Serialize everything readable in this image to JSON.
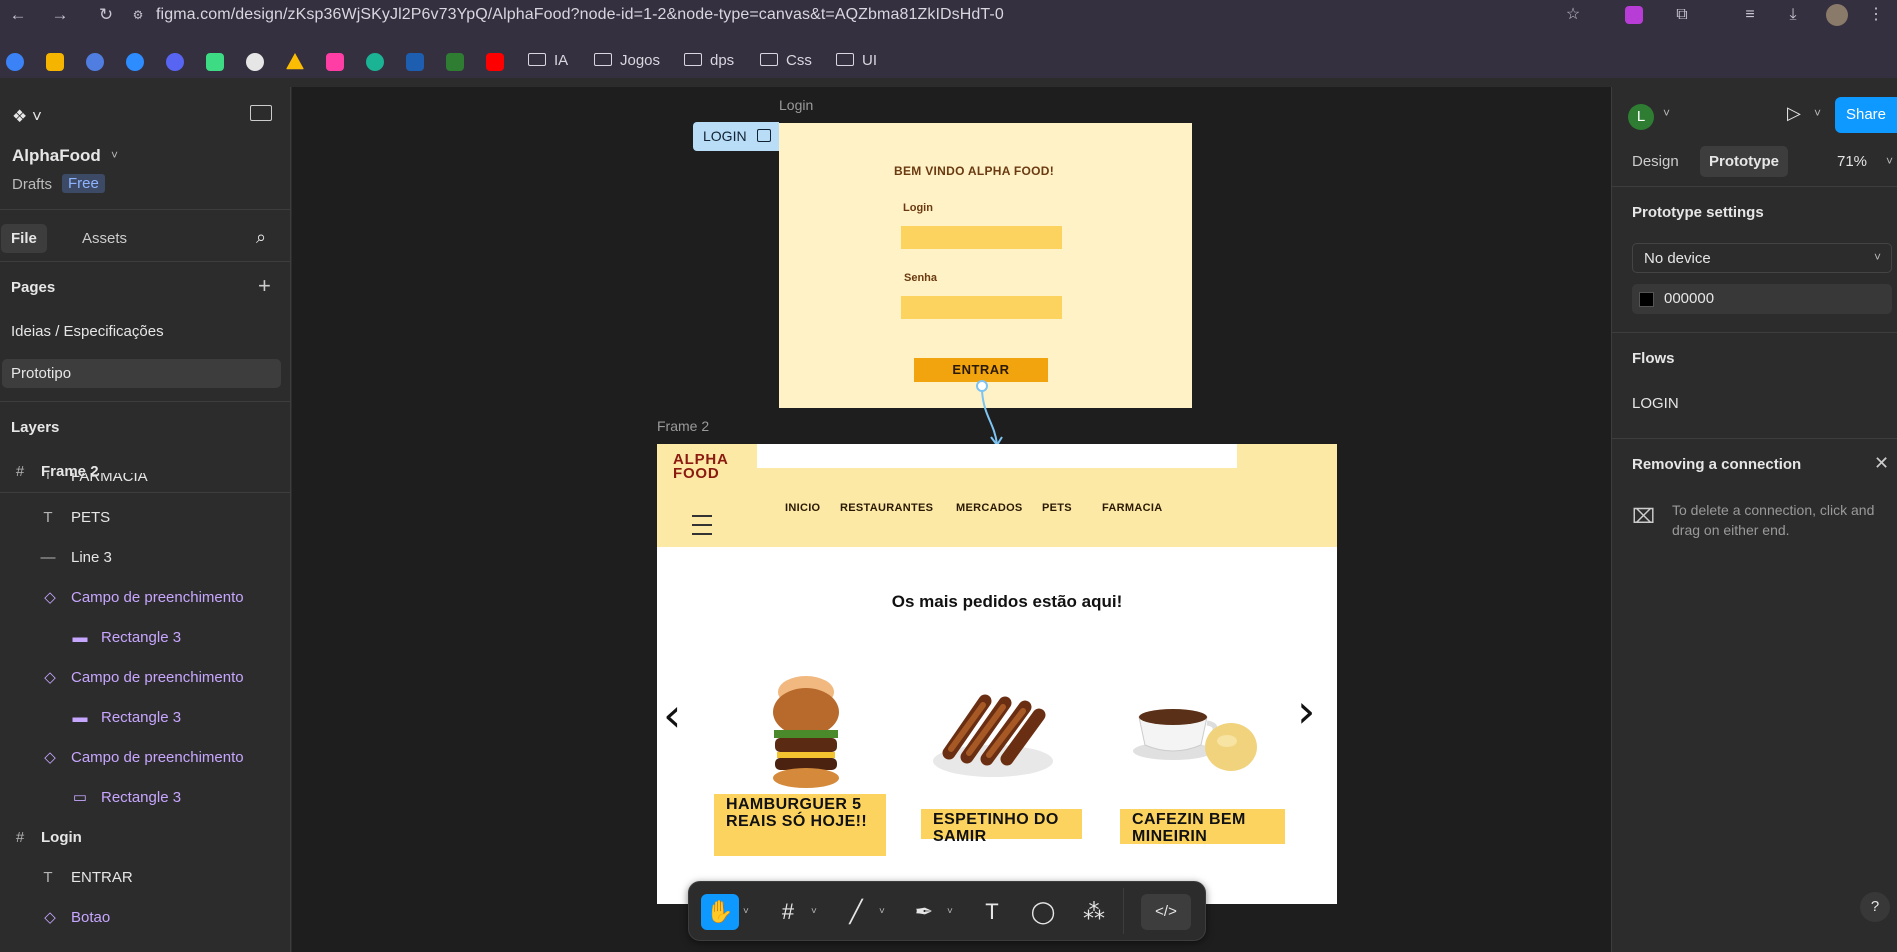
{
  "browser": {
    "url": "figma.com/design/zKsp36WjSKyJl2P6v73YpQ/AlphaFood?node-id=1-2&node-type=canvas&t=AQZbma81ZkIDsHdT-0",
    "bookmark_folders": [
      "IA",
      "Jogos",
      "dps",
      "Css",
      "UI"
    ]
  },
  "left_panel": {
    "file_name": "AlphaFood",
    "drafts_label": "Drafts",
    "plan_badge": "Free",
    "tabs": [
      "File",
      "Assets"
    ],
    "pages_title": "Pages",
    "pages": [
      "Ideias / Especificações",
      "Prototipo"
    ],
    "layers_title": "Layers",
    "layers": [
      {
        "name": "Frame 2",
        "icon": "frame-icon"
      },
      {
        "name": "FARMACIA",
        "icon": "text-icon"
      },
      {
        "name": "PETS",
        "icon": "text-icon"
      },
      {
        "name": "Line 3",
        "icon": "line-icon"
      },
      {
        "name": "Campo de preenchimento",
        "icon": "component-icon"
      },
      {
        "name": "Rectangle 3",
        "icon": "rectangle-icon"
      },
      {
        "name": "Campo de preenchimento",
        "icon": "component-icon"
      },
      {
        "name": "Rectangle 3",
        "icon": "rectangle-icon"
      },
      {
        "name": "Campo de preenchimento",
        "icon": "component-icon"
      },
      {
        "name": "Rectangle 3",
        "icon": "rectangle-icon"
      },
      {
        "name": "Login",
        "icon": "frame-icon"
      },
      {
        "name": "ENTRAR",
        "icon": "text-icon"
      },
      {
        "name": "Botao",
        "icon": "component-icon"
      }
    ]
  },
  "canvas": {
    "login_frame_label": "Login",
    "login_flow_tag": "LOGIN",
    "login": {
      "title": "BEM VINDO ALPHA FOOD!",
      "login_label": "Login",
      "senha_label": "Senha",
      "button": "ENTRAR"
    },
    "frame2_label": "Frame 2",
    "frame2": {
      "logo_line1": "ALPHA",
      "logo_line2": "FOOD",
      "menu": [
        "INICIO",
        "RESTAURANTES",
        "MERCADOS",
        "PETS",
        "FARMACIA"
      ],
      "headline": "Os mais pedidos estão aqui!",
      "cards": [
        {
          "title": "HAMBURGUER 5 REAIS SÓ HOJE!!"
        },
        {
          "title": "ESPETINHO DO SAMIR"
        },
        {
          "title": "CAFEZIN BEM MINEIRIN"
        }
      ]
    }
  },
  "right_panel": {
    "avatar_letter": "L",
    "share_label": "Share",
    "tabs": [
      "Design",
      "Prototype"
    ],
    "zoom": "71%",
    "prototype_settings_title": "Prototype settings",
    "device": "No device",
    "background_color": "000000",
    "flows_title": "Flows",
    "flow_name": "LOGIN",
    "hint_title": "Removing a connection",
    "hint_text": "To delete a connection, click and drag on either end.",
    "help": "?"
  },
  "colors": {
    "figma_panel": "#2c2c2c",
    "canvas": "#1e1e1e",
    "share_button": "#0d99ff",
    "login_bg": "#fff2c7",
    "field": "#fcd35e",
    "enter_button": "#f2a40e"
  }
}
